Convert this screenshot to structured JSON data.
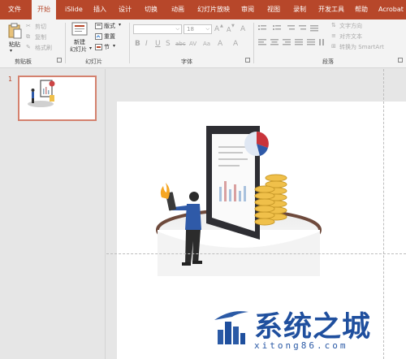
{
  "tabs": [
    {
      "label": "文件"
    },
    {
      "label": "开始"
    },
    {
      "label": "iSlide"
    },
    {
      "label": "插入"
    },
    {
      "label": "设计"
    },
    {
      "label": "切换"
    },
    {
      "label": "动画"
    },
    {
      "label": "幻灯片放映"
    },
    {
      "label": "审阅"
    },
    {
      "label": "视图"
    },
    {
      "label": "录制"
    },
    {
      "label": "开发工具"
    },
    {
      "label": "帮助"
    },
    {
      "label": "Acrobat"
    }
  ],
  "clipboard": {
    "paste": "粘贴",
    "cut": "剪切",
    "copy": "复制",
    "format_painter": "格式刷",
    "group_label": "剪贴板"
  },
  "slides_group": {
    "new_slide_line1": "新建",
    "new_slide_line2": "幻灯片",
    "layout": "版式",
    "reset": "重置",
    "section": "节",
    "group_label": "幻灯片"
  },
  "font_group": {
    "font_name": "",
    "font_size": "18",
    "grow": "A",
    "shrink": "A",
    "clear": "A",
    "bold": "B",
    "italic": "I",
    "underline": "U",
    "shadow": "S",
    "strike": "abc",
    "spacing": "AV",
    "case": "Aa",
    "highlight": "A",
    "group_label": "字体"
  },
  "paragraph_group": {
    "text_direction": "文字方向",
    "align_text": "对齐文本",
    "smartart": "转换为 SmartArt",
    "group_label": "段落"
  },
  "slide_panel": {
    "slide_number": "1"
  },
  "watermark": {
    "title": "系统之城",
    "url": "xitong86.com"
  },
  "colors": {
    "accent": "#b7472a",
    "ribbon": "#f3f3f3",
    "workspace": "#e6e6e6",
    "watermark": "#1f4f9e",
    "illustration_blue": "#2f5aa8",
    "coin": "#f0c04a"
  }
}
